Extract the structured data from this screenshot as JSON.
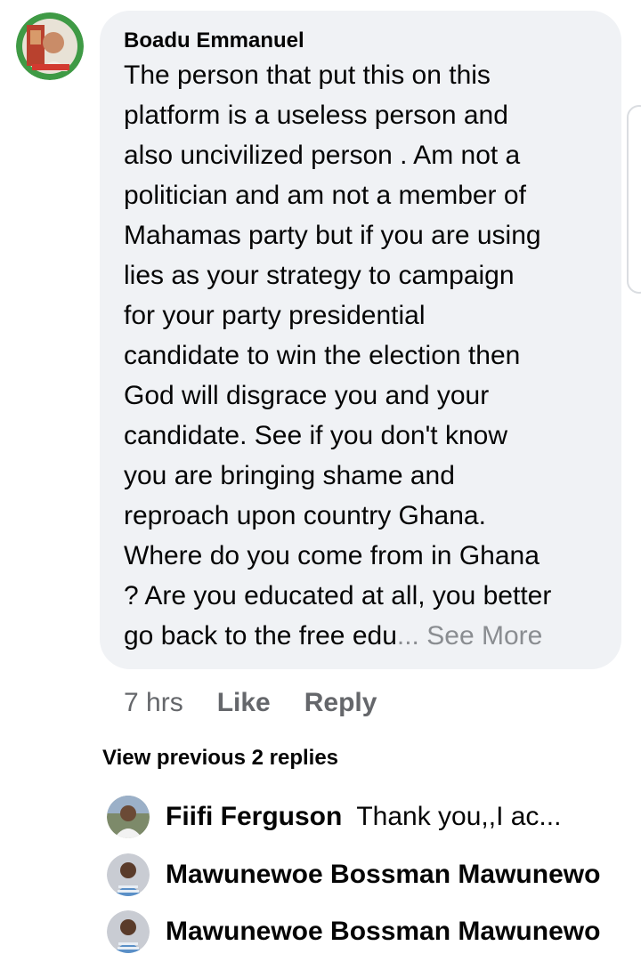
{
  "comment": {
    "author": "Boadu Emmanuel",
    "lines": [
      "The person that put this on this",
      "platform is a useless person and",
      "also uncivilized person . Am not a",
      "politician and am not a member of",
      "Mahamas party but if you are using",
      "lies as your strategy to campaign",
      "for your party presidential",
      "candidate to win the election then",
      "God will disgrace you and your",
      "candidate. See if you don't know",
      "you are bringing shame and",
      "reproach upon country Ghana.",
      "Where do you come from in Ghana",
      "? Are you educated at all, you better"
    ],
    "last_line": "go back to the free edu",
    "ellipsis": "...",
    "see_more": "See More",
    "time": "7 hrs",
    "like_label": "Like",
    "reply_label": "Reply"
  },
  "replies": {
    "view_previous": "View previous 2 replies",
    "items": [
      {
        "name": "Fiifi Ferguson",
        "text": "Thank you,,I ac..."
      },
      {
        "name": "Mawunewoe Bossman Mawunewo",
        "text": ""
      },
      {
        "name": "Mawunewoe Bossman Mawunewo",
        "text": ""
      }
    ]
  },
  "colors": {
    "bubble_bg": "#f0f2f5",
    "meta_text": "#65676b",
    "see_more": "#8a8d91"
  }
}
